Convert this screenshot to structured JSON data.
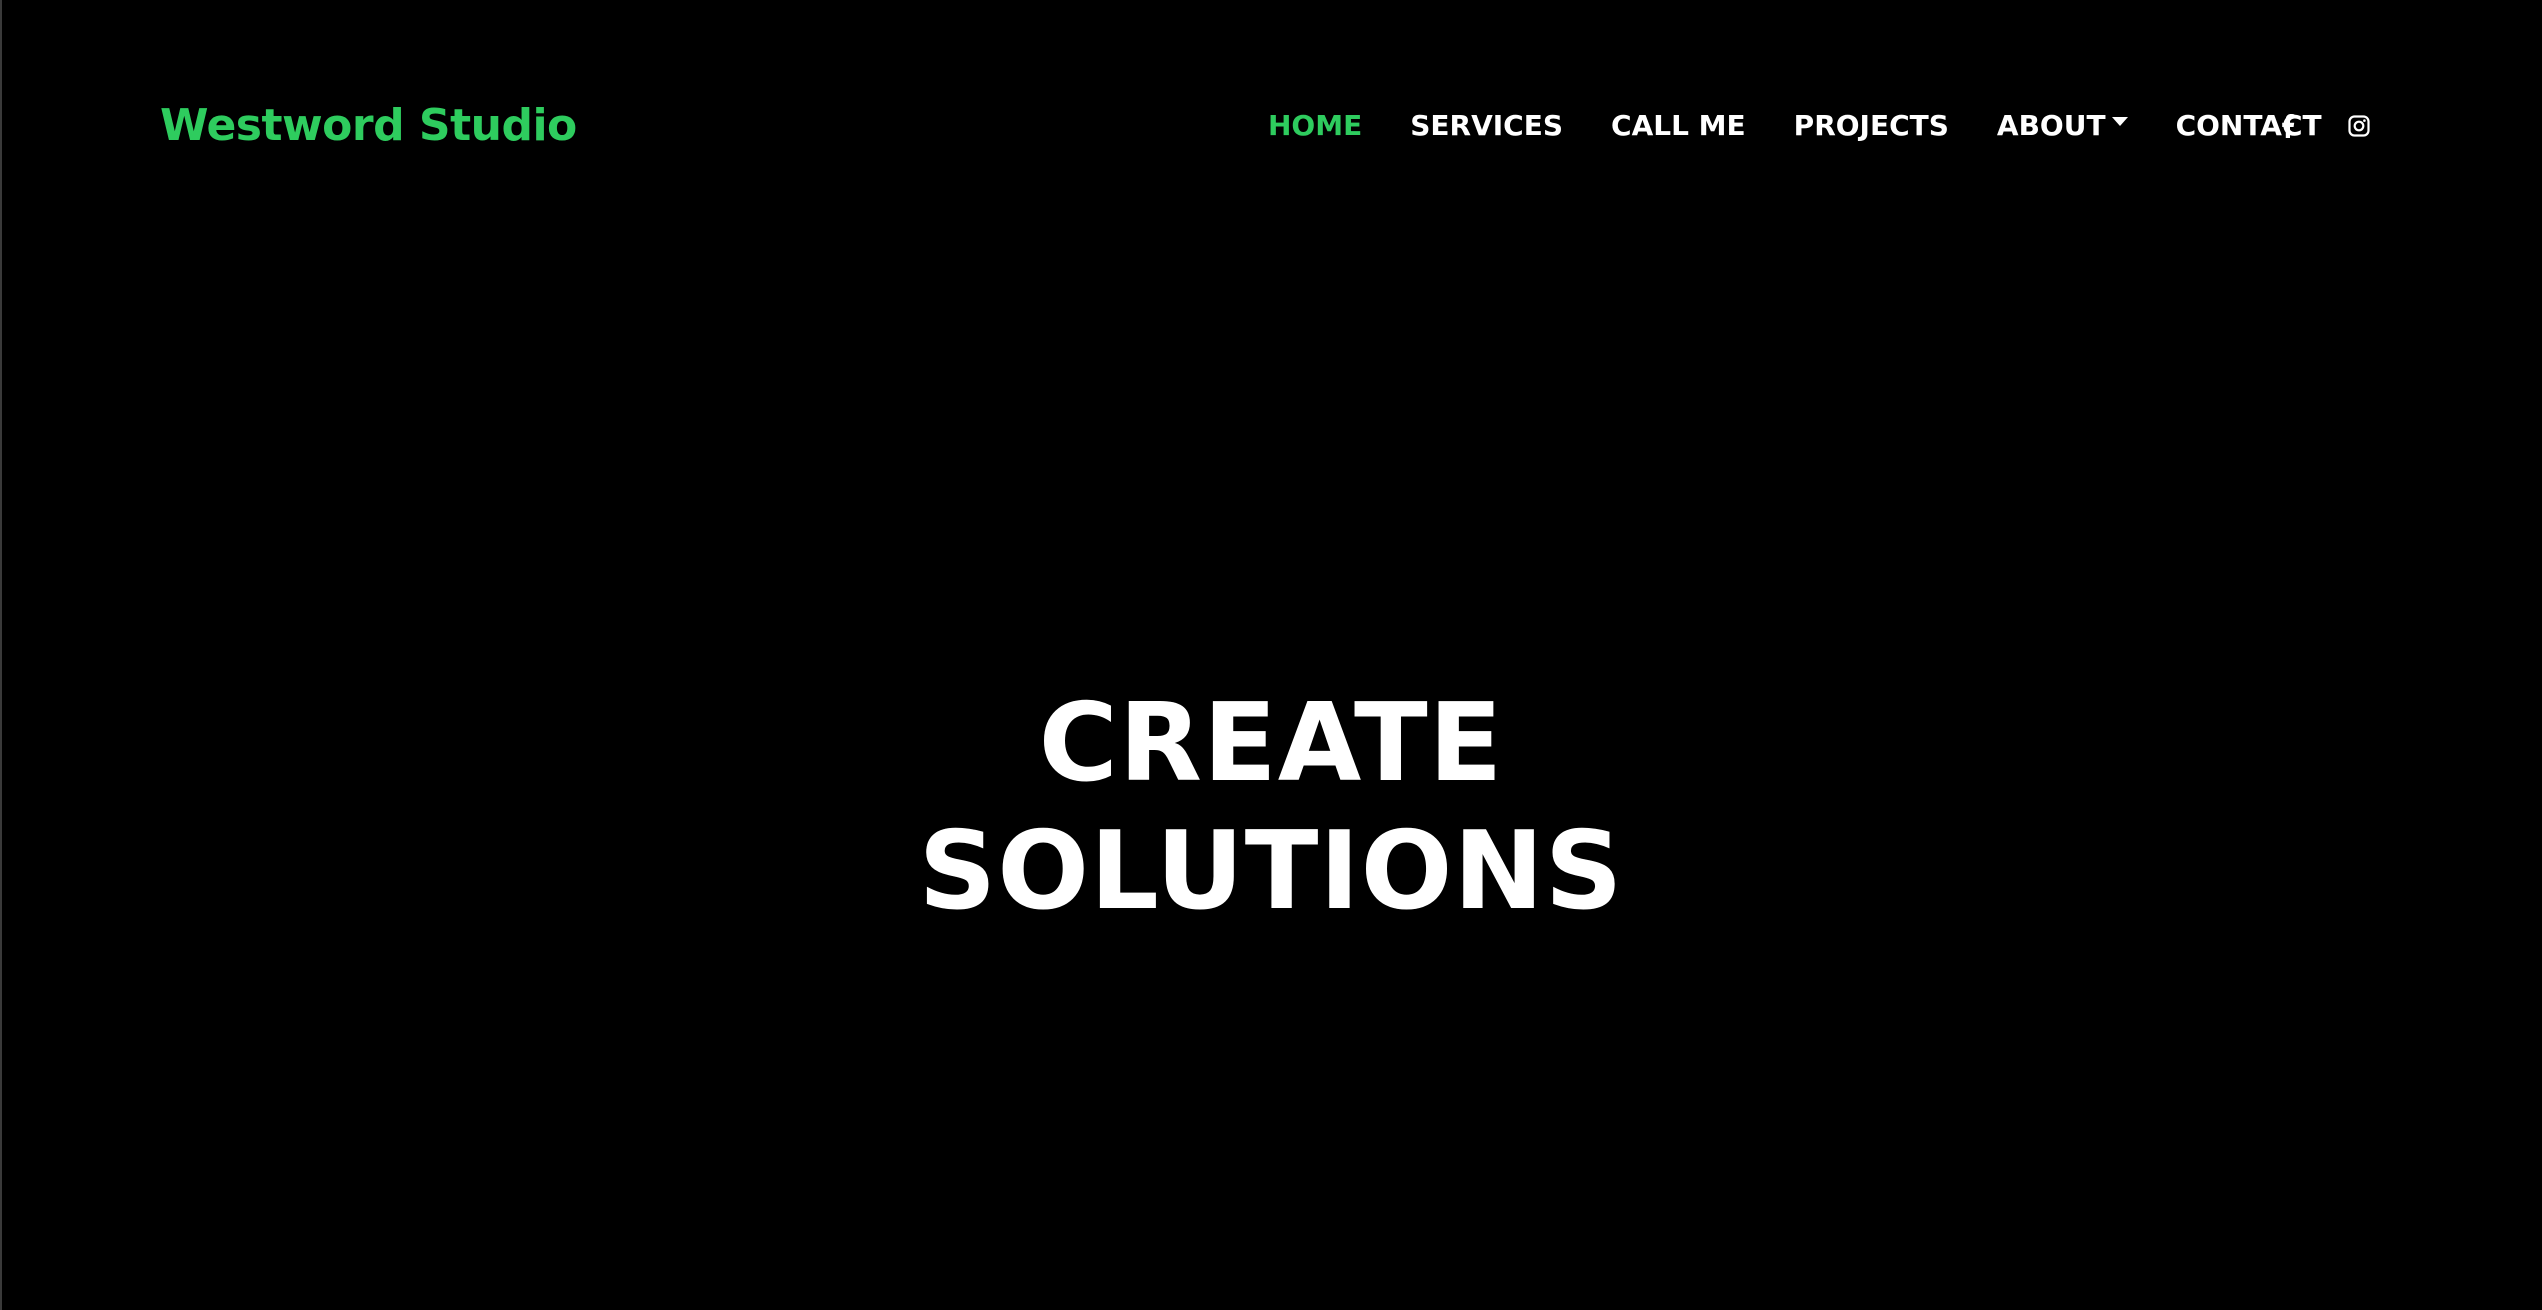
{
  "brand": {
    "name": "Westword Studio",
    "color": "#2ecc5e"
  },
  "nav": {
    "items": [
      {
        "label": "HOME",
        "active": true
      },
      {
        "label": "SERVICES",
        "active": false
      },
      {
        "label": "CALL ME",
        "active": false
      },
      {
        "label": "PROJECTS",
        "active": false
      },
      {
        "label": "ABOUT",
        "active": false,
        "dropdown": true
      },
      {
        "label": "CONTACT",
        "active": false
      }
    ],
    "social": [
      {
        "icon": "facebook-icon"
      },
      {
        "icon": "instagram-icon"
      }
    ]
  },
  "hero": {
    "line1": "CREATE",
    "line2": "SOLUTIONS"
  },
  "colors": {
    "background": "#000000",
    "accent": "#2ecc5e",
    "text": "#ffffff"
  }
}
